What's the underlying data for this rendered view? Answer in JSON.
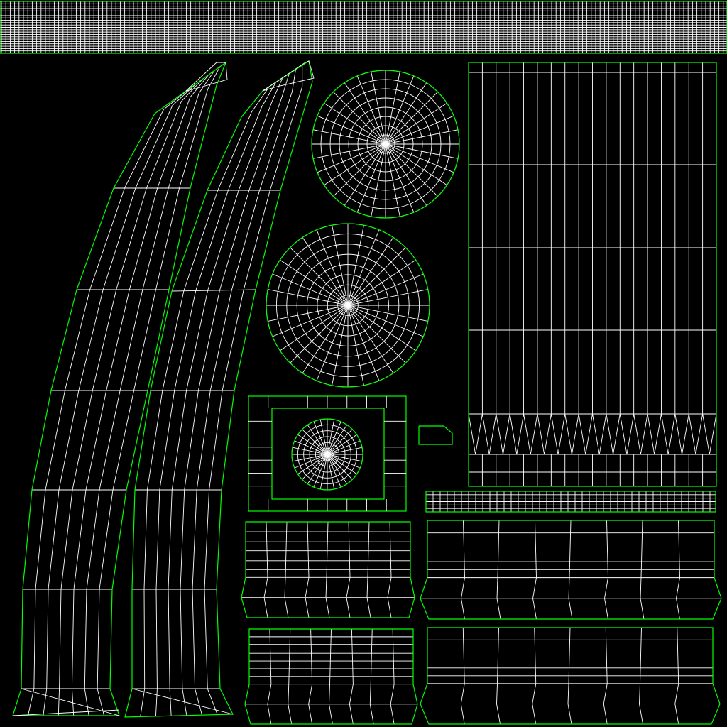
{
  "canvas": {
    "background_color": "#000000",
    "border_color": "#00ff00",
    "wire_color": "#ffffff"
  },
  "uv_islands": [
    {
      "name": "top-strip-dense-grid"
    },
    {
      "name": "left-curved-strip-1"
    },
    {
      "name": "left-curved-strip-2"
    },
    {
      "name": "radial-disc-top"
    },
    {
      "name": "radial-disc-middle"
    },
    {
      "name": "framed-square-with-disc"
    },
    {
      "name": "tall-vertical-grid-with-zigzag"
    },
    {
      "name": "small-rectangle"
    },
    {
      "name": "thin-horizontal-strip"
    },
    {
      "name": "bottom-grid-block-left-upper"
    },
    {
      "name": "bottom-grid-block-right-upper"
    },
    {
      "name": "bottom-grid-block-left-lower"
    },
    {
      "name": "bottom-grid-block-right-lower"
    }
  ]
}
